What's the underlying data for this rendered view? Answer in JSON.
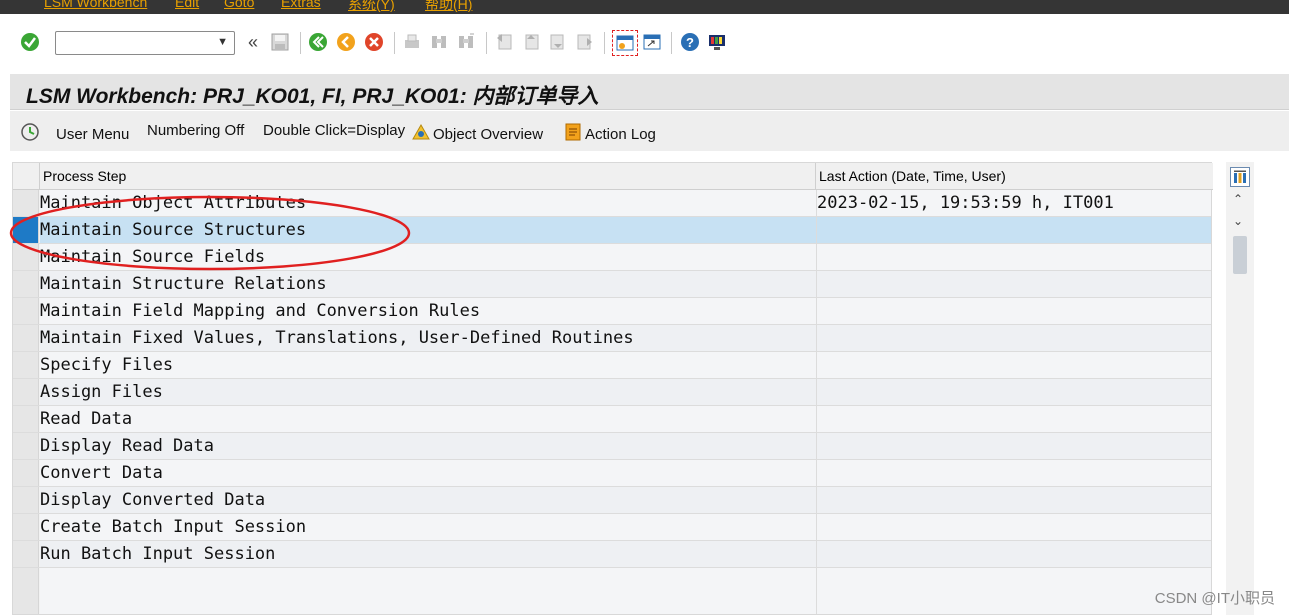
{
  "menu": [
    {
      "label": "LSM Workbench"
    },
    {
      "label": "Edit"
    },
    {
      "label": "Goto"
    },
    {
      "label": "Extras"
    },
    {
      "label": "系统(Y)"
    },
    {
      "label": "帮助(H)"
    }
  ],
  "toolbar": {
    "command_value": "",
    "icons": [
      "enter-check-icon",
      "back-icon",
      "exit-icon",
      "cancel-icon",
      "print-icon",
      "find-icon",
      "find-next-icon",
      "first-page-icon",
      "prev-page-icon",
      "next-page-icon",
      "last-page-icon",
      "create-session-icon",
      "shortcut-icon",
      "help-icon",
      "customize-icon"
    ]
  },
  "title": "LSM Workbench: PRJ_KO01, FI, PRJ_KO01: 内部订单导入",
  "app_toolbar": {
    "user_menu": "User Menu",
    "numbering": "Numbering Off",
    "double_click": "Double Click=Display",
    "object_overview": "Object Overview",
    "action_log": "Action Log"
  },
  "table": {
    "columns": [
      "Process Step",
      "Last Action (Date, Time, User)"
    ],
    "rows": [
      {
        "step": "Maintain Object Attributes",
        "last": "2023-02-15, 19:53:59 h, IT001"
      },
      {
        "step": "Maintain Source Structures",
        "last": ""
      },
      {
        "step": "Maintain Source Fields",
        "last": ""
      },
      {
        "step": "Maintain Structure Relations",
        "last": ""
      },
      {
        "step": "Maintain Field Mapping and Conversion Rules",
        "last": ""
      },
      {
        "step": "Maintain Fixed Values, Translations, User-Defined Routines",
        "last": ""
      },
      {
        "step": "Specify Files",
        "last": ""
      },
      {
        "step": "Assign Files",
        "last": ""
      },
      {
        "step": "Read Data",
        "last": ""
      },
      {
        "step": "Display Read Data",
        "last": ""
      },
      {
        "step": "Convert Data",
        "last": ""
      },
      {
        "step": "Display Converted Data",
        "last": ""
      },
      {
        "step": "Create Batch Input Session",
        "last": ""
      },
      {
        "step": "Run Batch Input Session",
        "last": ""
      }
    ],
    "selected_row": 1
  },
  "watermark": "CSDN @IT小职员",
  "colors": {
    "menubar": "#353535",
    "menu_text": "#e8a000",
    "selected_row": "#c7e1f3",
    "selected_marker": "#1e7ac6",
    "annotation": "#e02020"
  }
}
